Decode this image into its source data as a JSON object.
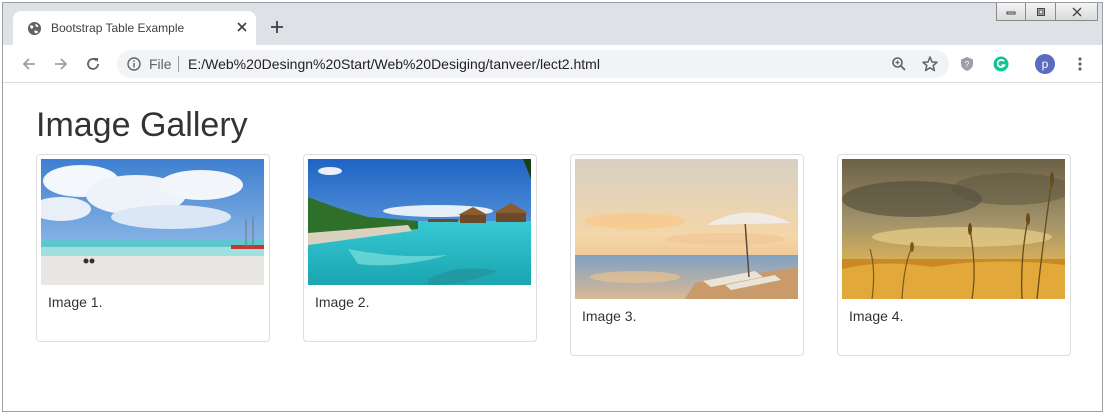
{
  "browser": {
    "tab_title": "Bootstrap Table Example",
    "omnibox": {
      "scheme_label": "File",
      "url": "E:/Web%20Desingn%20Start/Web%20Desiging/tanveer/lect2.html"
    },
    "profile_initial": "p",
    "icons": {
      "favicon": "globe-icon",
      "close": "close-icon",
      "new_tab": "plus-icon",
      "back": "back-arrow-icon",
      "forward": "forward-arrow-icon",
      "reload": "reload-icon",
      "info": "info-icon",
      "zoom": "zoom-icon",
      "bookmark": "star-icon",
      "extension_1": "shield-extension-icon",
      "extension_2": "grammarly-icon",
      "menu": "menu-dots-icon"
    },
    "colors": {
      "tabstrip": "#dee1e6",
      "omnibox": "#f1f3f4",
      "profile": "#5c6bc0",
      "grammarly": "#15c39a"
    }
  },
  "page": {
    "title": "Image Gallery",
    "gallery": [
      {
        "caption": "Image 1."
      },
      {
        "caption": "Image 2."
      },
      {
        "caption": "Image 3."
      },
      {
        "caption": "Image 4."
      }
    ]
  }
}
